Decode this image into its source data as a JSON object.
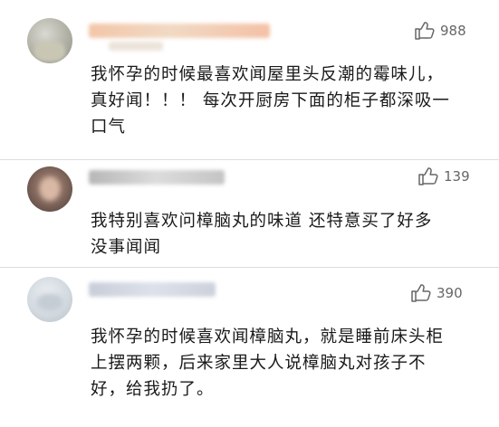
{
  "comments": [
    {
      "likes": "988",
      "lines": [
        "我怀孕的时候最喜欢闻屋里头反潮的霉味儿，",
        "真好闻！！！ 每次开厨房下面的柜子都深吸一",
        "口气"
      ]
    },
    {
      "likes": "139",
      "lines": [
        "我特别喜欢问樟脑丸的味道   还特意买了好多",
        "没事闻闻"
      ]
    },
    {
      "likes": "390",
      "lines": [
        "我怀孕的时候喜欢闻樟脑丸，就是睡前床头柜",
        "上摆两颗，后来家里大人说樟脑丸对孩子不",
        "好，给我扔了。"
      ]
    }
  ],
  "icons": {
    "like": "thumbs-up-icon"
  },
  "colors": {
    "text": "#1a1a1a",
    "meta": "#666666",
    "divider": "#dedede",
    "background": "#ffffff"
  }
}
